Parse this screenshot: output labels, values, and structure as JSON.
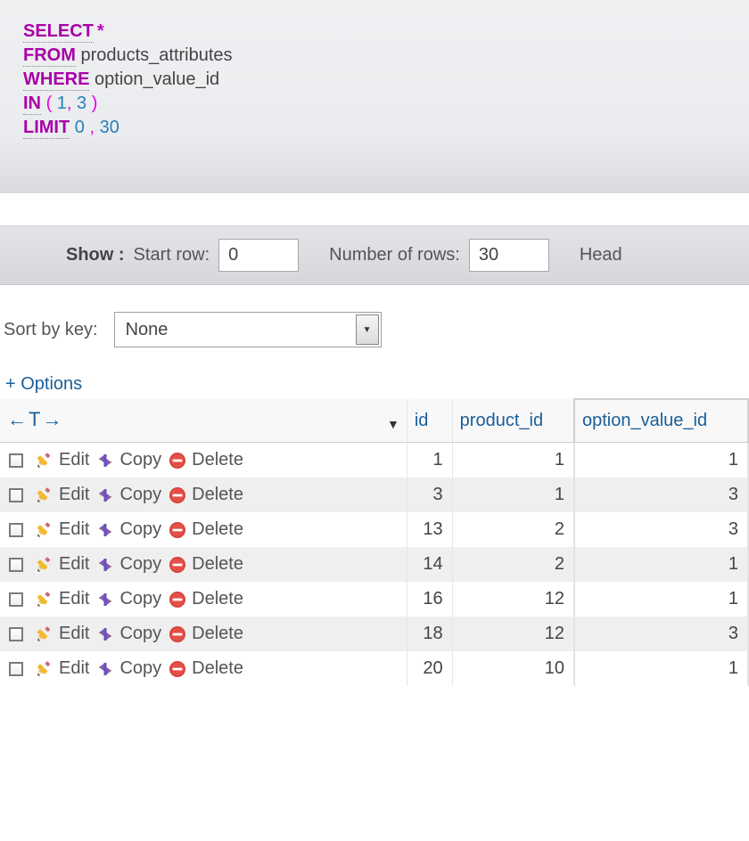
{
  "sql": {
    "select_kw": "SELECT",
    "star": "*",
    "from_kw": "FROM",
    "from_ident": "products_attributes",
    "where_kw": "WHERE",
    "where_ident": "option_value_id",
    "in_kw": "IN",
    "paren_open": "(",
    "in_val1": "1",
    "in_comma": ",",
    "in_val2": "3",
    "paren_close": ")",
    "limit_kw": "LIMIT",
    "limit_val1": "0",
    "limit_comma": ",",
    "limit_val2": "30"
  },
  "showbar": {
    "show_label": "Show :",
    "start_row_label": "Start row:",
    "start_row_value": "0",
    "num_rows_label": "Number of rows:",
    "num_rows_value": "30",
    "headers_label": "Head"
  },
  "sort": {
    "label": "Sort by key:",
    "selected": "None"
  },
  "options_link": "+ Options",
  "actions": {
    "edit": "Edit",
    "copy": "Copy",
    "delete": "Delete"
  },
  "table": {
    "headers": {
      "id": "id",
      "product_id": "product_id",
      "option_value_id": "option_value_id"
    },
    "rows": [
      {
        "id": "1",
        "product_id": "1",
        "option_value_id": "1",
        "alt": false
      },
      {
        "id": "3",
        "product_id": "1",
        "option_value_id": "3",
        "alt": true
      },
      {
        "id": "13",
        "product_id": "2",
        "option_value_id": "3",
        "alt": false
      },
      {
        "id": "14",
        "product_id": "2",
        "option_value_id": "1",
        "alt": true
      },
      {
        "id": "16",
        "product_id": "12",
        "option_value_id": "1",
        "alt": false
      },
      {
        "id": "18",
        "product_id": "12",
        "option_value_id": "3",
        "alt": true
      },
      {
        "id": "20",
        "product_id": "10",
        "option_value_id": "1",
        "alt": false
      }
    ]
  }
}
